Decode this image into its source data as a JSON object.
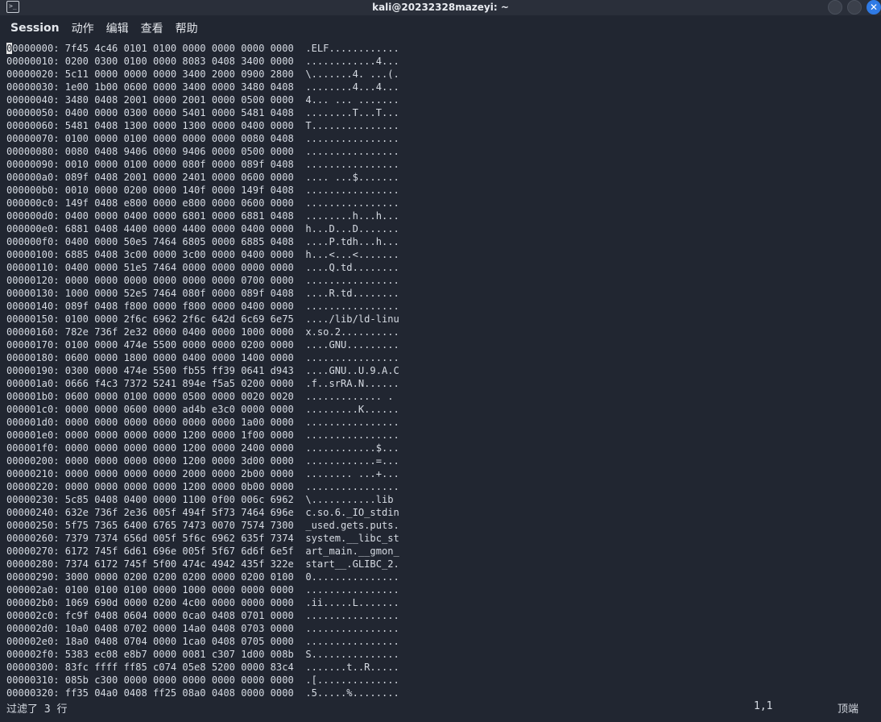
{
  "window": {
    "title": "kali@20232328mazeyi: ~"
  },
  "menu": [
    "Session",
    "动作",
    "编辑",
    "查看",
    "帮助"
  ],
  "icons": {
    "app": "terminal-icon",
    "minimize": "minimize-icon",
    "maximize": "maximize-icon",
    "close": "close-icon"
  },
  "colors": {
    "background": "#212631",
    "text": "#d6dbe3",
    "close_button": "#2f7ae5"
  },
  "lines": [
    "00000000: 7f45 4c46 0101 0100 0000 0000 0000 0000  .ELF............",
    "00000010: 0200 0300 0100 0000 8083 0408 3400 0000  ............4...",
    "00000020: 5c11 0000 0000 0000 3400 2000 0900 2800  \\.......4. ...(.",
    "00000030: 1e00 1b00 0600 0000 3400 0000 3480 0408  ........4...4...",
    "00000040: 3480 0408 2001 0000 2001 0000 0500 0000  4... ... .......",
    "00000050: 0400 0000 0300 0000 5401 0000 5481 0408  ........T...T...",
    "00000060: 5481 0408 1300 0000 1300 0000 0400 0000  T...............",
    "00000070: 0100 0000 0100 0000 0000 0000 0080 0408  ................",
    "00000080: 0080 0408 9406 0000 9406 0000 0500 0000  ................",
    "00000090: 0010 0000 0100 0000 080f 0000 089f 0408  ................",
    "000000a0: 089f 0408 2001 0000 2401 0000 0600 0000  .... ...$.......",
    "000000b0: 0010 0000 0200 0000 140f 0000 149f 0408  ................",
    "000000c0: 149f 0408 e800 0000 e800 0000 0600 0000  ................",
    "000000d0: 0400 0000 0400 0000 6801 0000 6881 0408  ........h...h...",
    "000000e0: 6881 0408 4400 0000 4400 0000 0400 0000  h...D...D.......",
    "000000f0: 0400 0000 50e5 7464 6805 0000 6885 0408  ....P.tdh...h...",
    "00000100: 6885 0408 3c00 0000 3c00 0000 0400 0000  h...<...<.......",
    "00000110: 0400 0000 51e5 7464 0000 0000 0000 0000  ....Q.td........",
    "00000120: 0000 0000 0000 0000 0000 0000 0700 0000  ................",
    "00000130: 1000 0000 52e5 7464 080f 0000 089f 0408  ....R.td........",
    "00000140: 089f 0408 f800 0000 f800 0000 0400 0000  ................",
    "00000150: 0100 0000 2f6c 6962 2f6c 642d 6c69 6e75  ..../lib/ld-linu",
    "00000160: 782e 736f 2e32 0000 0400 0000 1000 0000  x.so.2..........",
    "00000170: 0100 0000 474e 5500 0000 0000 0200 0000  ....GNU.........",
    "00000180: 0600 0000 1800 0000 0400 0000 1400 0000  ................",
    "00000190: 0300 0000 474e 5500 fb55 ff39 0641 d943  ....GNU..U.9.A.C",
    "000001a0: 0666 f4c3 7372 5241 894e f5a5 0200 0000  .f..srRA.N......",
    "000001b0: 0600 0000 0100 0000 0500 0000 0020 0020  ............. .",
    "000001c0: 0000 0000 0600 0000 ad4b e3c0 0000 0000  .........K......",
    "000001d0: 0000 0000 0000 0000 0000 0000 1a00 0000  ................",
    "000001e0: 0000 0000 0000 0000 1200 0000 1f00 0000  ................",
    "000001f0: 0000 0000 0000 0000 1200 0000 2400 0000  ............$...",
    "00000200: 0000 0000 0000 0000 1200 0000 3d00 0000  ............=...",
    "00000210: 0000 0000 0000 0000 2000 0000 2b00 0000  ........ ...+...",
    "00000220: 0000 0000 0000 0000 1200 0000 0b00 0000  ................",
    "00000230: 5c85 0408 0400 0000 1100 0f00 006c 6962  \\...........lib",
    "00000240: 632e 736f 2e36 005f 494f 5f73 7464 696e  c.so.6._IO_stdin",
    "00000250: 5f75 7365 6400 6765 7473 0070 7574 7300  _used.gets.puts.",
    "00000260: 7379 7374 656d 005f 5f6c 6962 635f 7374  system.__libc_st",
    "00000270: 6172 745f 6d61 696e 005f 5f67 6d6f 6e5f  art_main.__gmon_",
    "00000280: 7374 6172 745f 5f00 474c 4942 435f 322e  start__.GLIBC_2.",
    "00000290: 3000 0000 0200 0200 0200 0000 0200 0100  0...............",
    "000002a0: 0100 0100 0100 0000 1000 0000 0000 0000  ................",
    "000002b0: 1069 690d 0000 0200 4c00 0000 0000 0000  .ii.....L.......",
    "000002c0: fc9f 0408 0604 0000 0ca0 0408 0701 0000  ................",
    "000002d0: 10a0 0408 0702 0000 14a0 0408 0703 0000  ................",
    "000002e0: 18a0 0408 0704 0000 1ca0 0408 0705 0000  ................",
    "000002f0: 5383 ec08 e8b7 0000 0081 c307 1d00 008b  S...............",
    "00000300: 83fc ffff ff85 c074 05e8 5200 0000 83c4  .......t..R.....",
    "00000310: 085b c300 0000 0000 0000 0000 0000 0000  .[..............",
    "00000320: ff35 04a0 0408 ff25 08a0 0408 0000 0000  .5.....%........"
  ],
  "status": {
    "message": "过滤了 3 行",
    "position": "1,1",
    "location": "顶端"
  }
}
